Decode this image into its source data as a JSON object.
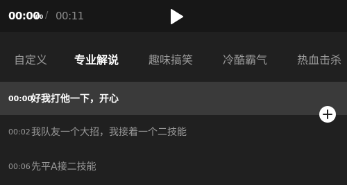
{
  "player": {
    "current_time": "00:00",
    "current_ms": "00",
    "separator": "/",
    "total_time": "00:11",
    "play_icon": "play-icon"
  },
  "tabs": [
    {
      "label": "自定义",
      "active": false
    },
    {
      "label": "专业解说",
      "active": true
    },
    {
      "label": "趣味搞笑",
      "active": false
    },
    {
      "label": "冷酷霸气",
      "active": false
    },
    {
      "label": "热血击杀",
      "active": false
    }
  ],
  "captions": [
    {
      "time": "00:00",
      "text": "好我打他一下，开心",
      "selected": true
    },
    {
      "time": "00:02",
      "text": "我队友一个大招，我接着一个二技能",
      "selected": false
    },
    {
      "time": "00:06",
      "text": "先平A接二技能",
      "selected": false
    }
  ],
  "add_button": {
    "icon": "plus-icon"
  },
  "colors": {
    "background": "#202020",
    "topbar": "#171717",
    "selected_row": "#3a3a3a",
    "active_text": "#ffffff",
    "inactive_text": "#9b9b9b"
  }
}
